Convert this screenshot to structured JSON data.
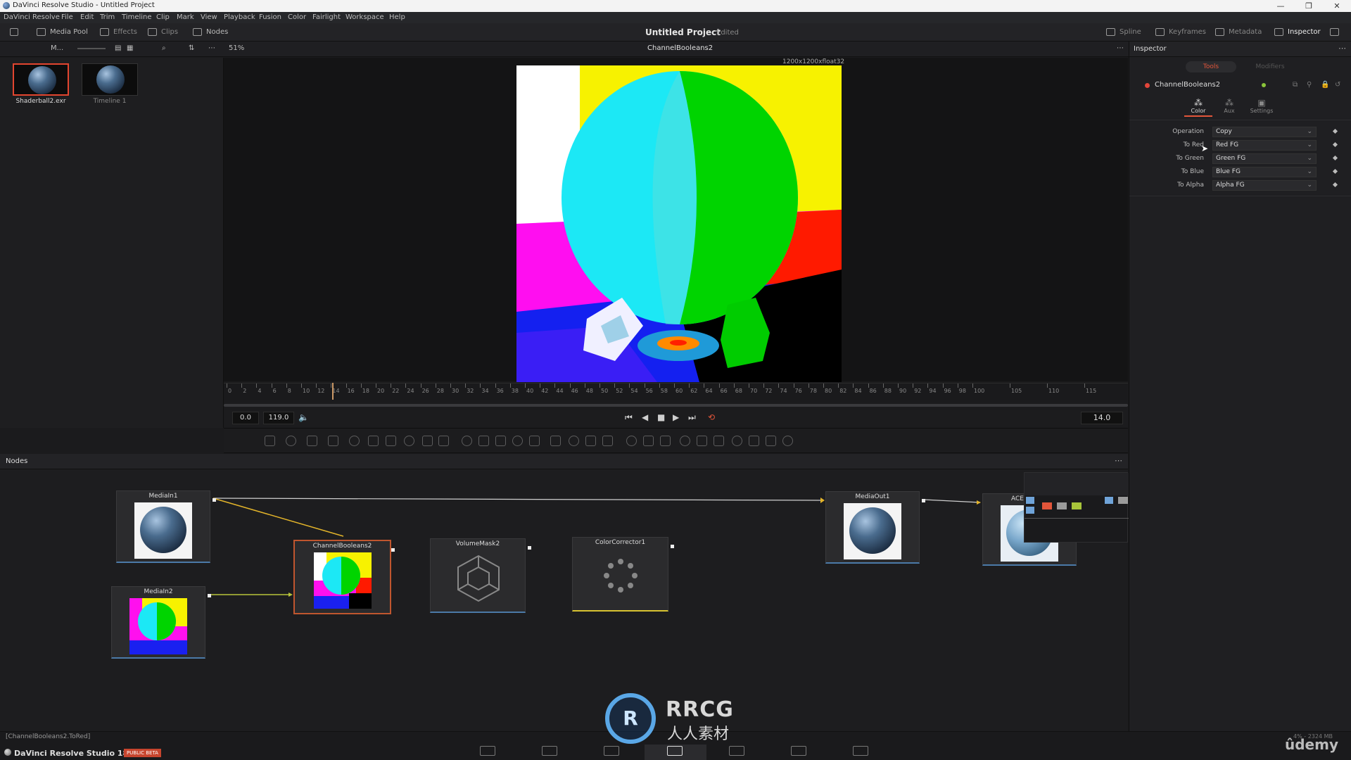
{
  "window": {
    "title": "DaVinci Resolve Studio - Untitled Project"
  },
  "menu": [
    "DaVinci Resolve",
    "File",
    "Edit",
    "Trim",
    "Timeline",
    "Clip",
    "Mark",
    "View",
    "Playback",
    "Fusion",
    "Color",
    "Fairlight",
    "Workspace",
    "Help"
  ],
  "toolbar": {
    "media_pool": "Media Pool",
    "effects": "Effects",
    "clips": "Clips",
    "nodes": "Nodes",
    "project_title": "Untitled Project",
    "edited": "Edited",
    "spline": "Spline",
    "keyframes": "Keyframes",
    "metadata": "Metadata",
    "inspector": "Inspector"
  },
  "subbar": {
    "pool_short": "M...",
    "zoom": "51%",
    "viewer_title": "ChannelBooleans2",
    "inspector_title": "Inspector"
  },
  "media_pool": {
    "clips": [
      {
        "name": "Shaderball2.exr",
        "selected": true
      },
      {
        "name": "Timeline 1",
        "selected": false
      }
    ]
  },
  "viewer": {
    "resolution": "1200x1200xfloat32"
  },
  "ruler": {
    "ticks": [
      "0",
      "2",
      "4",
      "6",
      "8",
      "10",
      "12",
      "14",
      "16",
      "18",
      "20",
      "22",
      "24",
      "26",
      "28",
      "30",
      "32",
      "34",
      "36",
      "38",
      "40",
      "42",
      "44",
      "46",
      "48",
      "50",
      "52",
      "54",
      "56",
      "58",
      "60",
      "62",
      "64",
      "66",
      "68",
      "70",
      "72",
      "74",
      "76",
      "78",
      "80",
      "82",
      "84",
      "86",
      "88",
      "90",
      "92",
      "94",
      "96",
      "98",
      "100",
      "105",
      "110",
      "115"
    ]
  },
  "transport": {
    "start": "0.0",
    "end": "119.0",
    "current": "14.0"
  },
  "nodes": {
    "header": "Nodes",
    "items": [
      {
        "id": "MediaIn1",
        "label": "MediaIn1"
      },
      {
        "id": "MediaIn2",
        "label": "MediaIn2"
      },
      {
        "id": "ChannelBooleans2",
        "label": "ChannelBooleans2"
      },
      {
        "id": "VolumeMask2",
        "label": "VolumeMask2"
      },
      {
        "id": "ColorCorrector1",
        "label": "ColorCorrector1"
      },
      {
        "id": "MediaOut1",
        "label": "MediaOut1"
      },
      {
        "id": "ACES",
        "label": "ACES"
      }
    ]
  },
  "inspector": {
    "tab_tools": "Tools",
    "tab_modifiers": "Modifiers",
    "node_name": "ChannelBooleans2",
    "subtabs": [
      "Color",
      "Aux",
      "Settings"
    ],
    "rows": [
      {
        "label": "Operation",
        "value": "Copy"
      },
      {
        "label": "To Red",
        "value": "Red   FG"
      },
      {
        "label": "To Green",
        "value": "Green FG"
      },
      {
        "label": "To Blue",
        "value": "Blue   FG"
      },
      {
        "label": "To Alpha",
        "value": "Alpha FG"
      }
    ]
  },
  "status": {
    "text": "[ChannelBooleans2.ToRed]",
    "brand": "DaVinci Resolve Studio 18.5",
    "beta": "PUBLIC BETA",
    "memory": "4% - 2324 MB"
  },
  "watermark": {
    "main": "RRCG",
    "sub": "人人素材",
    "logo": "R",
    "udemy": "ûdemy"
  }
}
